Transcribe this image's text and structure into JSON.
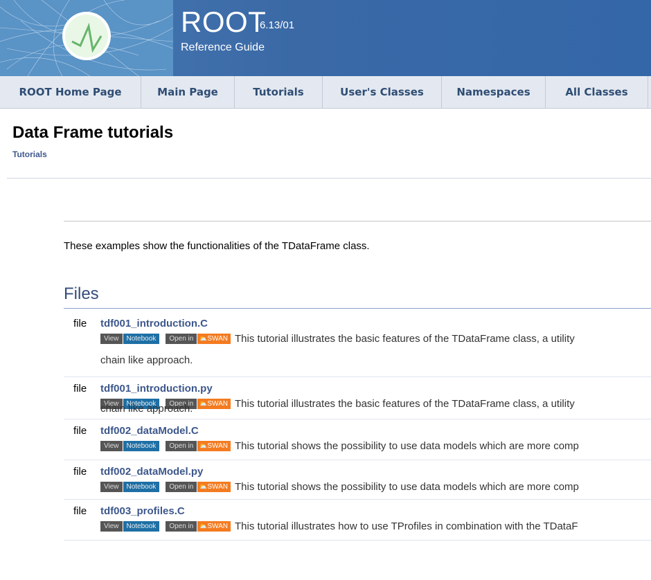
{
  "header": {
    "title": "ROOT",
    "version": "6.13/01",
    "subtitle": "Reference Guide"
  },
  "nav": [
    {
      "label": "ROOT Home Page"
    },
    {
      "label": "Main Page"
    },
    {
      "label": "Tutorials"
    },
    {
      "label": "User's Classes"
    },
    {
      "label": "Namespaces"
    },
    {
      "label": "All Classes"
    }
  ],
  "page": {
    "title": "Data Frame tutorials",
    "breadcrumb": "Tutorials",
    "intro": "These examples show the functionalities of the TDataFrame class.",
    "files_heading": "Files"
  },
  "buttons": {
    "view": "View",
    "notebook": "Notebook",
    "open_in": "Open in",
    "swan": "SWAN"
  },
  "files": [
    {
      "type": "file",
      "name": "tdf001_introduction.C",
      "desc": "This tutorial illustrates the basic features of the TDataFrame class, a utility",
      "desc2": "chain like approach."
    },
    {
      "type": "file",
      "name": "tdf001_introduction.py",
      "desc": "This tutorial illustrates the basic features of the TDataFrame class, a utility",
      "desc2": "chain like approach."
    },
    {
      "type": "file",
      "name": "tdf002_dataModel.C",
      "desc": "This tutorial shows the possibility to use data models which are more comp"
    },
    {
      "type": "file",
      "name": "tdf002_dataModel.py",
      "desc": "This tutorial shows the possibility to use data models which are more comp"
    },
    {
      "type": "file",
      "name": "tdf003_profiles.C",
      "desc": "This tutorial illustrates how to use TProfiles in combination with the TDataF"
    }
  ]
}
